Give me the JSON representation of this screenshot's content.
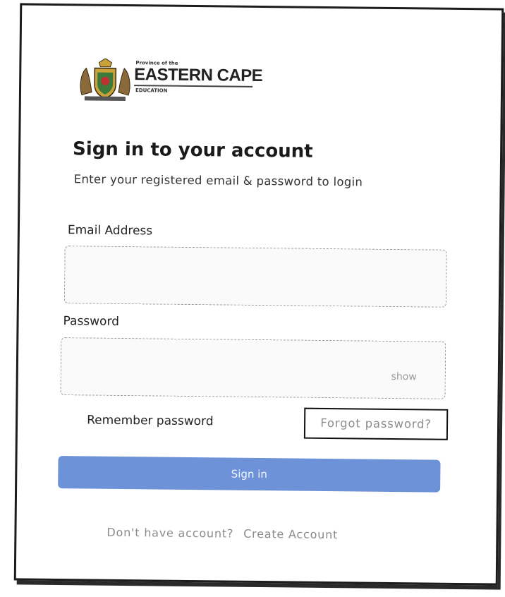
{
  "logo": {
    "province_text": "Province of the",
    "name": "EASTERN CAPE",
    "department": "EDUCATION"
  },
  "login": {
    "title": "Sign in to your account",
    "subtitle": "Enter your registered email & password to login",
    "email_label": "Email Address",
    "email_value": "",
    "password_label": "Password",
    "password_value": "",
    "show_label": "show",
    "remember_label": "Remember password",
    "forgot_label": "Forgot password?",
    "signin_label": "Sign in",
    "no_account_text": "Don't have account?",
    "create_account_label": "Create Account"
  },
  "colors": {
    "primary_button": "#6d92d8",
    "muted_text": "#8a8a8a",
    "border": "#1c1c1c"
  }
}
